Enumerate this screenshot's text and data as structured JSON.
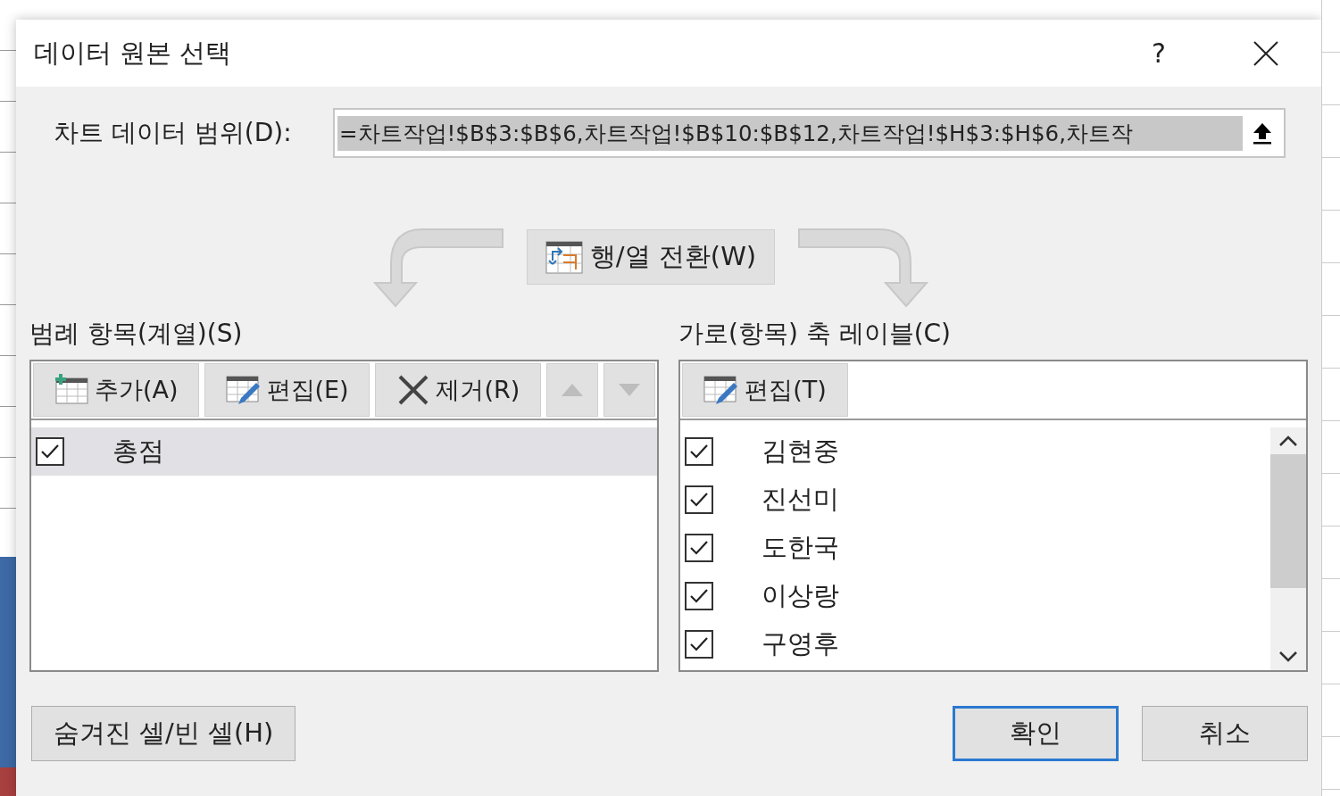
{
  "window": {
    "title": "데이터 원본 선택",
    "help": "?"
  },
  "range": {
    "label": "차트 데이터 범위(D):",
    "value": "=차트작업!$B$3:$B$6,차트작업!$B$10:$B$12,차트작업!$H$3:$H$6,차트작",
    "selected": true
  },
  "switch_button": "행/열 전환(W)",
  "legend": {
    "label": "범례 항목(계열)(S)",
    "buttons": [
      {
        "kind": "add",
        "label": "추가(A)"
      },
      {
        "kind": "edit",
        "label": "편집(E)"
      },
      {
        "kind": "remove",
        "label": "제거(R)"
      },
      {
        "kind": "up",
        "disabled": true
      },
      {
        "kind": "down",
        "disabled": true
      }
    ],
    "items": [
      {
        "label": "총점",
        "checked": true,
        "selected": true
      }
    ]
  },
  "axis": {
    "label": "가로(항목) 축 레이블(C)",
    "buttons": [
      {
        "kind": "edit",
        "label": "편집(T)"
      }
    ],
    "items": [
      {
        "label": "김현중",
        "checked": true,
        "selected": false
      },
      {
        "label": "진선미",
        "checked": true,
        "selected": false
      },
      {
        "label": "도한국",
        "checked": true,
        "selected": false
      },
      {
        "label": "이상랑",
        "checked": true,
        "selected": false
      },
      {
        "label": "구영후",
        "checked": true,
        "selected": false
      }
    ]
  },
  "footer": {
    "hidden_cells_button": "숨겨진 셀/빈 셀(H)",
    "ok": "확인",
    "cancel": "취소"
  }
}
